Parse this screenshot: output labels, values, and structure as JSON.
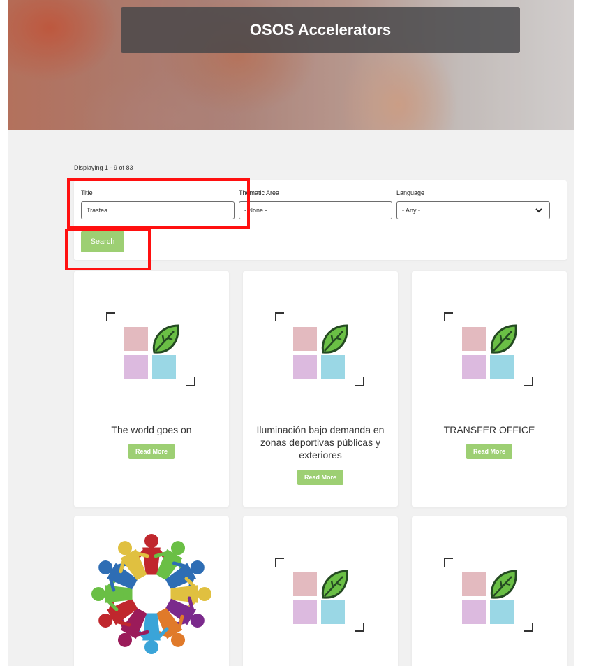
{
  "header": {
    "title": "OSOS Accelerators"
  },
  "results": {
    "count_text": "Displaying 1 - 9 of 83"
  },
  "filters": {
    "title_label": "Title",
    "title_value": "Trastea",
    "thematic_label": "Thematic Area",
    "thematic_value": "- None -",
    "language_label": "Language",
    "language_value": "- Any -",
    "search_label": "Search"
  },
  "cards": [
    {
      "title": "The world goes on",
      "button": "Read More",
      "image": "placeholder-leaf-logo"
    },
    {
      "title": "Iluminación bajo demanda en zonas deportivas públicas y exteriores",
      "button": "Read More",
      "image": "placeholder-leaf-logo"
    },
    {
      "title": "TRANSFER OFFICE",
      "button": "Read More",
      "image": "placeholder-leaf-logo"
    },
    {
      "title": "",
      "button": "",
      "image": "people-circle-logo"
    },
    {
      "title": "",
      "button": "",
      "image": "placeholder-leaf-logo"
    },
    {
      "title": "",
      "button": "",
      "image": "placeholder-leaf-logo"
    }
  ],
  "colors": {
    "accent_green": "#9dcf73",
    "highlight_red": "#ff1010",
    "title_bar": "#464648",
    "tile_pink": "#e0b3b8",
    "tile_purple": "#d8b2db",
    "tile_blue": "#8fd3e2",
    "leaf_green": "#6abf45"
  }
}
